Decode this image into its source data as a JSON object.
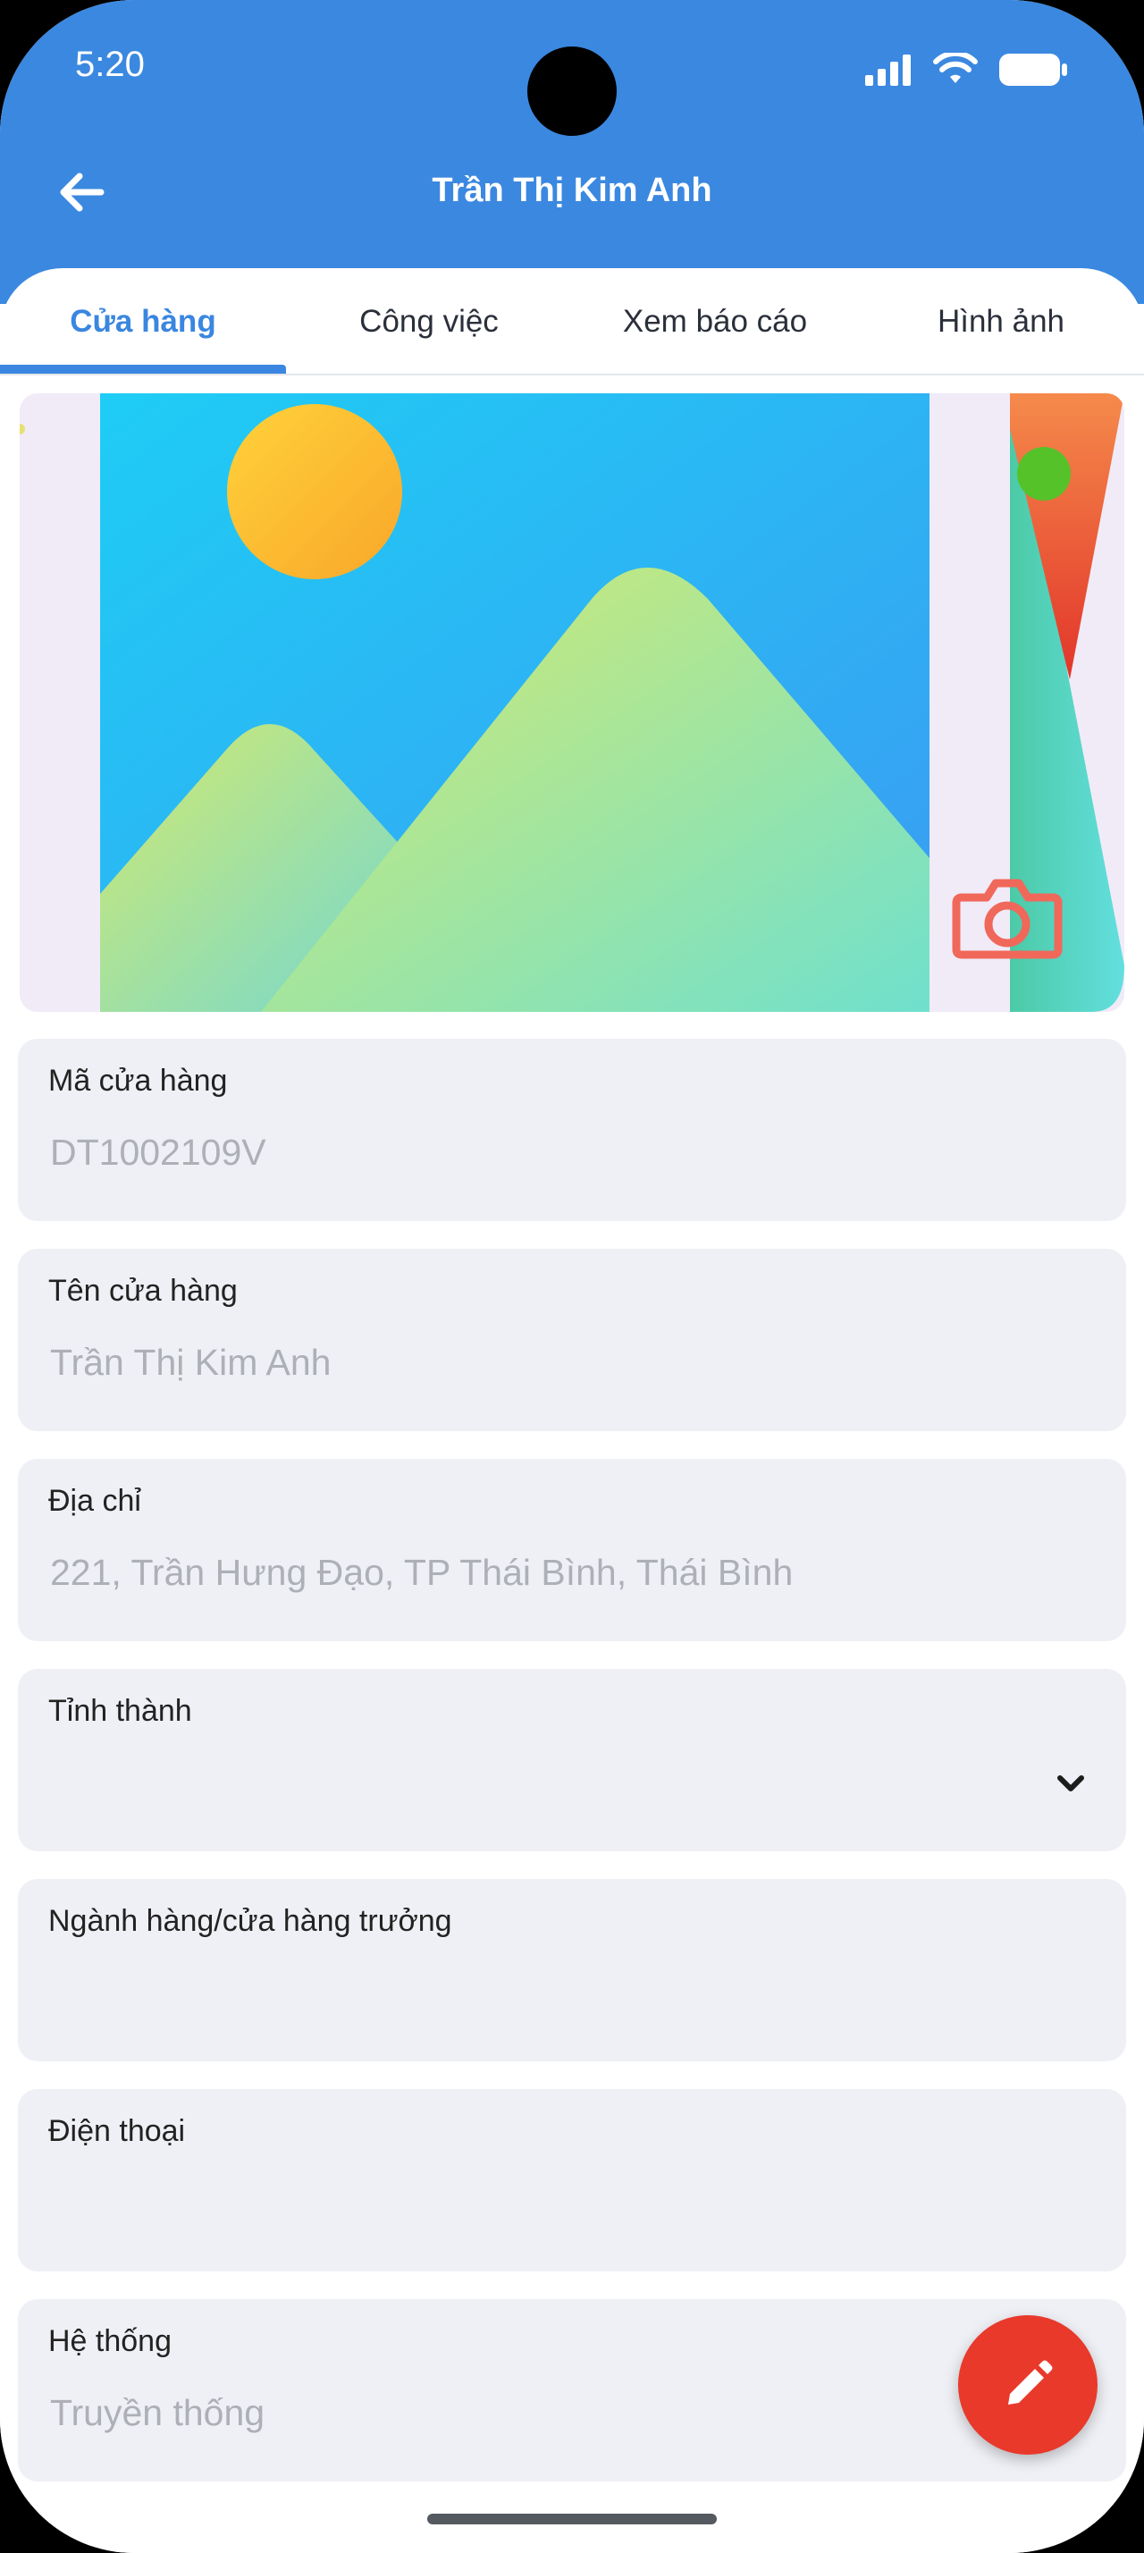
{
  "status": {
    "time": "5:20"
  },
  "header": {
    "title": "Trần Thị Kim Anh"
  },
  "tabs": [
    {
      "label": "Cửa hàng",
      "active": true
    },
    {
      "label": "Công việc",
      "active": false
    },
    {
      "label": "Xem báo cáo",
      "active": false
    },
    {
      "label": "Hình ảnh",
      "active": false
    }
  ],
  "fields": [
    {
      "label": "Mã cửa hàng",
      "value": "DT1002109V"
    },
    {
      "label": "Tên cửa hàng",
      "value": "Trần Thị Kim Anh"
    },
    {
      "label": "Địa chỉ",
      "value": "221, Trần Hưng Đạo, TP Thái Bình, Thái Bình"
    },
    {
      "label": "Tỉnh thành",
      "value": ""
    },
    {
      "label": "Ngành hàng/cửa hàng trưởng",
      "value": ""
    },
    {
      "label": "Điện thoại",
      "value": ""
    },
    {
      "label": "Hệ thống",
      "value": "Truyền thống"
    }
  ],
  "colors": {
    "primary": "#3b88e0",
    "fab": "#e8392b",
    "field_bg": "#eff0f5"
  },
  "icons": {
    "back": "arrow-left-icon",
    "camera": "camera-icon",
    "edit": "pencil-icon",
    "dropdown": "chevron-down-icon"
  }
}
